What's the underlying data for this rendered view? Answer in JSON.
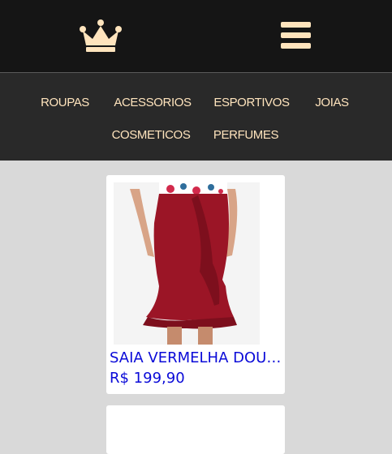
{
  "header": {
    "logo_icon": "crown-icon",
    "menu_icon": "hamburger-menu-icon",
    "accent_color": "#ffe4bd",
    "background_color": "#151515"
  },
  "nav": {
    "items": [
      {
        "label": "ROUPAS"
      },
      {
        "label": "ACESSORIOS"
      },
      {
        "label": "ESPORTIVOS"
      },
      {
        "label": "JOIAS"
      },
      {
        "label": "COSMETICOS"
      },
      {
        "label": "PERFUMES"
      }
    ]
  },
  "products": [
    {
      "image": "product-photo",
      "name": "SAIA VERMELHA DOURADA",
      "price": "R$ 199,90"
    }
  ],
  "colors": {
    "link": "#0a0ad8",
    "page_background": "#d9d9d9",
    "nav_background": "#292929",
    "skirt": "#9b1526"
  }
}
